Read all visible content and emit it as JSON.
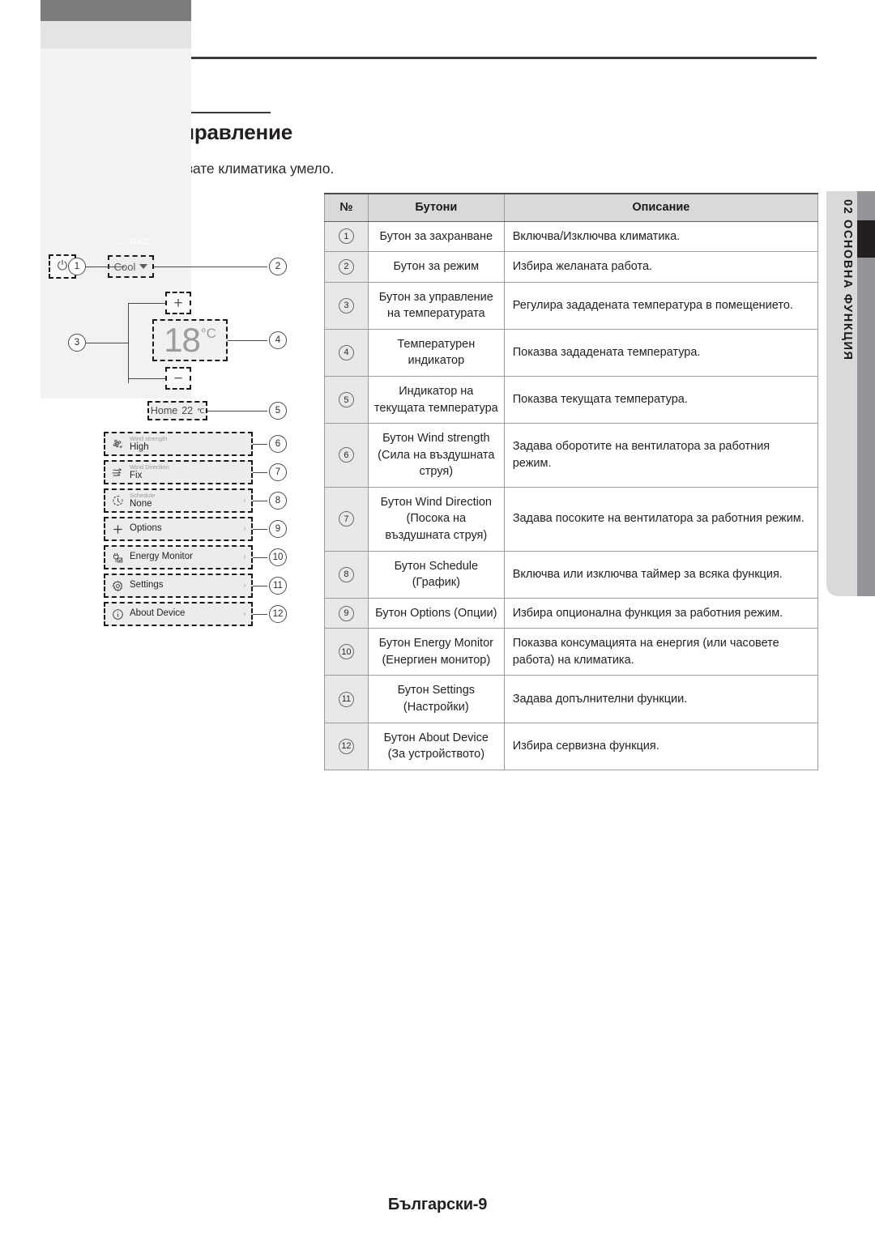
{
  "page": {
    "heading": "Екран за управление",
    "subheading": "Можете да управлявате климатика умело.",
    "footer": "Български-9",
    "side_tab": "02  ОСНОВНА ФУНКЦИЯ"
  },
  "device": {
    "topbar": {
      "back_icon": "back-arrow-icon",
      "title": "RAC"
    },
    "power_icon": "power-icon",
    "mode": {
      "label": "Cool",
      "caret_icon": "caret-down-icon"
    },
    "plus_label": "+",
    "minus_label": "−",
    "set_temp": {
      "value": "18",
      "unit": "°C"
    },
    "current_temp": {
      "label": "Home",
      "value": "22",
      "unit": "℃"
    },
    "menu": [
      {
        "icon": "fan-icon",
        "sub": "Wind strength",
        "main": "High",
        "chevron": ""
      },
      {
        "icon": "arrows-icon",
        "sub": "Wind Direction",
        "main": "Fix",
        "chevron": ""
      },
      {
        "icon": "clock-icon",
        "sub": "Schedule",
        "main": "None",
        "chevron": "›"
      },
      {
        "icon": "plus-icon",
        "sub": "",
        "main": "Options",
        "chevron": "›"
      },
      {
        "icon": "plug-icon",
        "sub": "",
        "main": "Energy Monitor",
        "chevron": "›"
      },
      {
        "icon": "gear-icon",
        "sub": "",
        "main": "Settings",
        "chevron": "›"
      },
      {
        "icon": "info-icon",
        "sub": "",
        "main": "About Device",
        "chevron": "›"
      }
    ],
    "callouts": [
      "①",
      "②",
      "③",
      "④",
      "⑤",
      "⑥",
      "⑦",
      "⑧",
      "⑨",
      "⑩",
      "⑪",
      "⑫"
    ]
  },
  "table": {
    "headers": {
      "no": "№",
      "buttons": "Бутони",
      "description": "Описание"
    },
    "rows": [
      {
        "no": "1",
        "button": "Бутон за захранване",
        "desc": "Включва/Изключва климатика."
      },
      {
        "no": "2",
        "button": "Бутон за режим",
        "desc": "Избира желаната работа."
      },
      {
        "no": "3",
        "button": "Бутон за управление на температурата",
        "desc": "Регулира зададената температура в помещението."
      },
      {
        "no": "4",
        "button": "Температурен индикатор",
        "desc": "Показва зададената температура."
      },
      {
        "no": "5",
        "button": "Индикатор на текущата температура",
        "desc": "Показва текущата температура."
      },
      {
        "no": "6",
        "button": "Бутон Wind strength (Сила на въздушната струя)",
        "desc": "Задава оборотите на вентилатора за работния режим."
      },
      {
        "no": "7",
        "button": "Бутон Wind Direction (Посока на въздушната струя)",
        "desc": "Задава посоките на вентилатора за работния режим."
      },
      {
        "no": "8",
        "button": "Бутон Schedule (График)",
        "desc": "Включва или изключва таймер за всяка функция."
      },
      {
        "no": "9",
        "button": "Бутон Options (Опции)",
        "desc": "Избира опционална функция за работния режим."
      },
      {
        "no": "10",
        "button": "Бутон Energy Monitor (Енергиен монитор)",
        "desc": "Показва консумацията на енергия (или часовете работа) на климатика."
      },
      {
        "no": "11",
        "button": "Бутон Settings (Настройки)",
        "desc": "Задава допълнителни функции."
      },
      {
        "no": "12",
        "button": "Бутон About Device (За устройството)",
        "desc": "Избира сервизна функция."
      }
    ]
  },
  "colors": {
    "header_bg": "#d9d9d9",
    "no_col_bg": "#e8e8e8",
    "side_tab_bg": "#d7d9db",
    "side_bar_gray": "#939598",
    "side_bar_dark": "#231f20",
    "text": "#231f20"
  }
}
